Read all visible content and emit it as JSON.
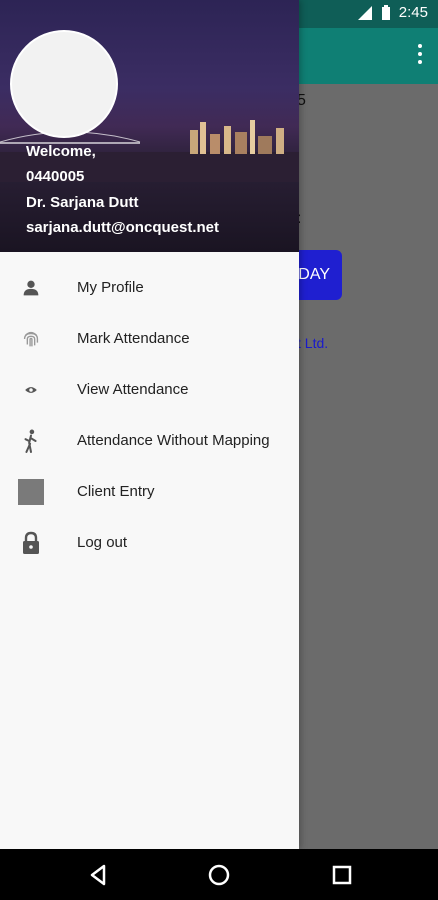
{
  "status_bar": {
    "time": "2:45"
  },
  "background": {
    "fragment_5": "5",
    "fragment_colon": ":",
    "button_label": "DAY",
    "link_text": "vt Ltd."
  },
  "drawer": {
    "welcome": "Welcome,",
    "id": "0440005",
    "name": "Dr. Sarjana Dutt",
    "email": "sarjana.dutt@oncquest.net",
    "items": [
      {
        "label": "My Profile",
        "icon": "person-icon"
      },
      {
        "label": "Mark Attendance",
        "icon": "fingerprint-icon"
      },
      {
        "label": "View Attendance",
        "icon": "eye-icon"
      },
      {
        "label": "Attendance Without Mapping",
        "icon": "walking-icon"
      },
      {
        "label": "Client Entry",
        "icon": "square-icon"
      },
      {
        "label": "Log out",
        "icon": "lock-icon"
      }
    ]
  },
  "colors": {
    "appbar": "#0f7f74",
    "statusbar": "#0f5e57",
    "button": "#1f1fd0",
    "scrim": "#6b6b6b"
  }
}
